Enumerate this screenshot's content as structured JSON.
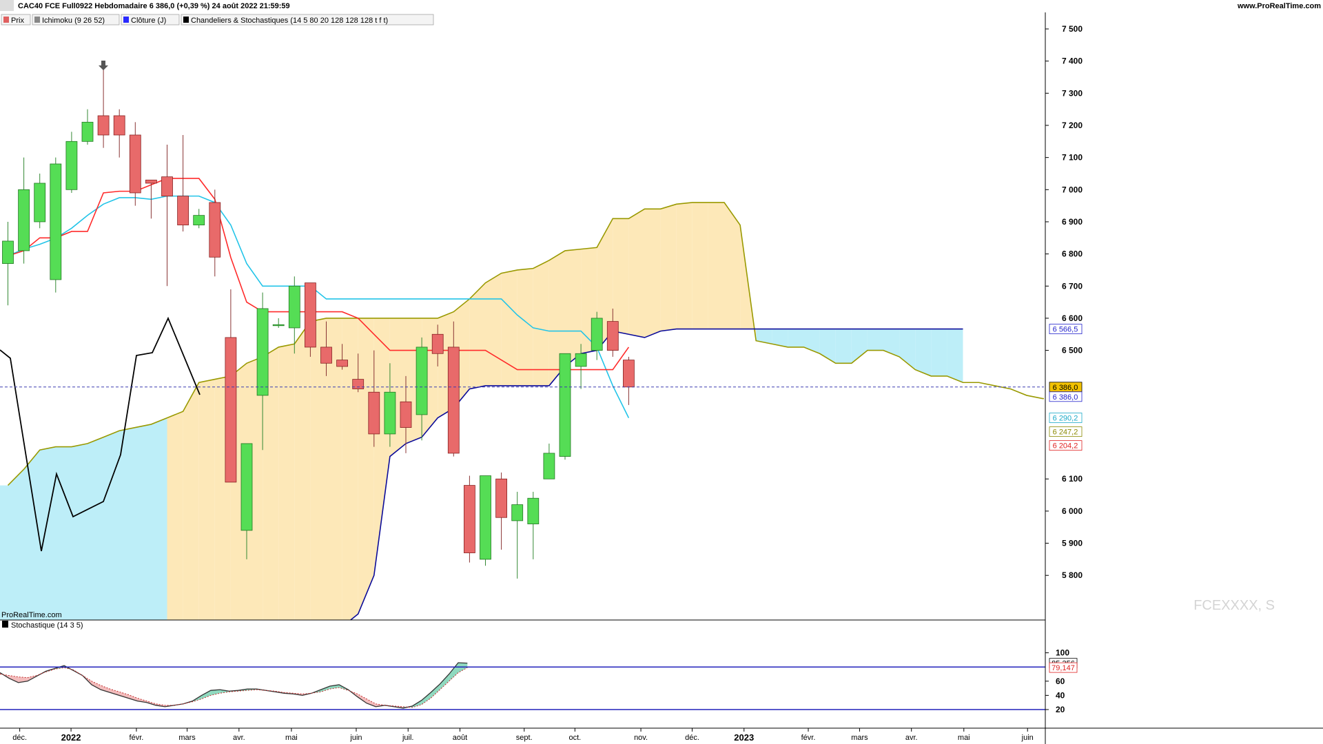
{
  "header": {
    "title": "CAC40 FCE Full0922 Hebdomadaire 6 386,0 (+0,39 %) 24 août 2022 21:59:59",
    "site": "www.ProRealTime.com",
    "legend": [
      {
        "label": "Prix",
        "color": "#e06060"
      },
      {
        "label": "Ichimoku (9 26 52)",
        "color": "#888888"
      },
      {
        "label": "Clôture (J)",
        "color": "#2a2aff"
      },
      {
        "label": "Chandeliers & Stochastiques (14 5 80 20 128 128 128 t f t)",
        "color": "#000000"
      }
    ]
  },
  "watermark": "FCEXXXX, S",
  "copyright": "ProRealTime.com",
  "stoch_panel": {
    "legend": "Stochastique (14 3 5)"
  },
  "price_axis": {
    "ticks": [
      "7 500",
      "7 400",
      "7 300",
      "7 200",
      "7 100",
      "7 000",
      "6 900",
      "6 800",
      "6 700",
      "6 600",
      "6 500",
      "6 100",
      "6 000",
      "5 900",
      "5 800"
    ],
    "tick_values": [
      7500,
      7400,
      7300,
      7200,
      7100,
      7000,
      6900,
      6800,
      6700,
      6600,
      6500,
      6100,
      6000,
      5900,
      5800
    ],
    "last_price_label": "6 386",
    "tags": [
      {
        "text": "6 566,5",
        "value": 6566.5,
        "color": "#2222cc",
        "bg": "#ffffff"
      },
      {
        "text": "6 386,0",
        "value": 6386,
        "color": "#000000",
        "bg": "#f2c200"
      },
      {
        "text": "6 386,0",
        "value": 6386,
        "color": "#2222cc",
        "bg": "#ffffff",
        "below": true
      },
      {
        "text": "6 290,2",
        "value": 6290.2,
        "color": "#1aaac8",
        "bg": "#ffffff"
      },
      {
        "text": "6 247,2",
        "value": 6247.2,
        "color": "#8a8a00",
        "bg": "#ffffff"
      },
      {
        "text": "6 204,2",
        "value": 6204.2,
        "color": "#e02020",
        "bg": "#ffffff"
      }
    ]
  },
  "stoch_axis": {
    "ticks": [
      "100",
      "60",
      "40",
      "20"
    ],
    "tick_values": [
      100,
      60,
      40,
      20
    ],
    "tags": [
      {
        "text": "85,356",
        "value": 85.356,
        "color": "#000000"
      },
      {
        "text": "79,147",
        "value": 79.147,
        "color": "#e02020"
      }
    ]
  },
  "time_axis": [
    {
      "label": "déc.",
      "bold": false
    },
    {
      "label": "2022",
      "bold": true
    },
    {
      "label": "févr.",
      "bold": false
    },
    {
      "label": "mars",
      "bold": false
    },
    {
      "label": "avr.",
      "bold": false
    },
    {
      "label": "mai",
      "bold": false
    },
    {
      "label": "juin",
      "bold": false
    },
    {
      "label": "juil.",
      "bold": false
    },
    {
      "label": "août",
      "bold": false
    },
    {
      "label": "sept.",
      "bold": false
    },
    {
      "label": "oct.",
      "bold": false
    },
    {
      "label": "nov.",
      "bold": false
    },
    {
      "label": "déc.",
      "bold": false
    },
    {
      "label": "2023",
      "bold": true
    },
    {
      "label": "févr.",
      "bold": false
    },
    {
      "label": "mars",
      "bold": false
    },
    {
      "label": "avr.",
      "bold": false
    },
    {
      "label": "mai",
      "bold": false
    },
    {
      "label": "juin",
      "bold": false
    }
  ],
  "colors": {
    "bull": "#55dd55",
    "bear": "#e86a6a",
    "kumo_bull": "#bdeef8",
    "kumo_bear": "#fde8b8",
    "tenkan": "#ff2a2a",
    "kijun": "#22c4e8",
    "ssa": "#0a0a99",
    "ssb": "#999900",
    "chikou": "#000000",
    "stoch_k": "#e05050",
    "stoch_line": "#2020bb"
  },
  "chart_data": {
    "type": "candlestick",
    "timeframe": "weekly",
    "candles": [
      {
        "o": 6770,
        "h": 6900,
        "l": 6640,
        "c": 6840
      },
      {
        "o": 6810,
        "h": 7100,
        "l": 6770,
        "c": 7000
      },
      {
        "o": 6900,
        "h": 7050,
        "l": 6880,
        "c": 7020
      },
      {
        "o": 6720,
        "h": 7100,
        "l": 6680,
        "c": 7080
      },
      {
        "o": 7000,
        "h": 7180,
        "l": 6990,
        "c": 7150
      },
      {
        "o": 7150,
        "h": 7250,
        "l": 7140,
        "c": 7210
      },
      {
        "o": 7230,
        "h": 7385,
        "l": 7130,
        "c": 7170
      },
      {
        "o": 7230,
        "h": 7250,
        "l": 7100,
        "c": 7170
      },
      {
        "o": 7170,
        "h": 7210,
        "l": 6950,
        "c": 6990
      },
      {
        "o": 7030,
        "h": 7030,
        "l": 6910,
        "c": 7020
      },
      {
        "o": 7040,
        "h": 7140,
        "l": 6700,
        "c": 6980
      },
      {
        "o": 6980,
        "h": 7170,
        "l": 6870,
        "c": 6890
      },
      {
        "o": 6890,
        "h": 6940,
        "l": 6880,
        "c": 6920
      },
      {
        "o": 6960,
        "h": 7000,
        "l": 6730,
        "c": 6790
      },
      {
        "o": 6540,
        "h": 6690,
        "l": 6180,
        "c": 6090
      },
      {
        "o": 5940,
        "h": 6200,
        "l": 5850,
        "c": 6210
      },
      {
        "o": 6360,
        "h": 6680,
        "l": 6190,
        "c": 6630
      },
      {
        "o": 6580,
        "h": 6600,
        "l": 6570,
        "c": 6580
      },
      {
        "o": 6570,
        "h": 6730,
        "l": 6490,
        "c": 6700
      },
      {
        "o": 6710,
        "h": 6710,
        "l": 6480,
        "c": 6510
      },
      {
        "o": 6510,
        "h": 6590,
        "l": 6420,
        "c": 6460
      },
      {
        "o": 6470,
        "h": 6520,
        "l": 6440,
        "c": 6450
      },
      {
        "o": 6410,
        "h": 6490,
        "l": 6370,
        "c": 6380
      },
      {
        "o": 6370,
        "h": 6500,
        "l": 6200,
        "c": 6240
      },
      {
        "o": 6240,
        "h": 6460,
        "l": 6200,
        "c": 6370
      },
      {
        "o": 6340,
        "h": 6420,
        "l": 6180,
        "c": 6260
      },
      {
        "o": 6300,
        "h": 6540,
        "l": 6220,
        "c": 6510
      },
      {
        "o": 6550,
        "h": 6580,
        "l": 6450,
        "c": 6490
      },
      {
        "o": 6510,
        "h": 6590,
        "l": 6170,
        "c": 6180
      },
      {
        "o": 6080,
        "h": 6110,
        "l": 5840,
        "c": 5870
      },
      {
        "o": 5850,
        "h": 6110,
        "l": 5830,
        "c": 6110
      },
      {
        "o": 6100,
        "h": 6120,
        "l": 5880,
        "c": 5980
      },
      {
        "o": 5970,
        "h": 6060,
        "l": 5790,
        "c": 6020
      },
      {
        "o": 5960,
        "h": 6060,
        "l": 5850,
        "c": 6040
      },
      {
        "o": 6100,
        "h": 6210,
        "l": 6120,
        "c": 6180
      },
      {
        "o": 6170,
        "h": 6490,
        "l": 6160,
        "c": 6490
      },
      {
        "o": 6450,
        "h": 6520,
        "l": 6380,
        "c": 6490
      },
      {
        "o": 6500,
        "h": 6620,
        "l": 6470,
        "c": 6600
      },
      {
        "o": 6590,
        "h": 6630,
        "l": 6480,
        "c": 6500
      },
      {
        "o": 6470,
        "h": 6480,
        "l": 6330,
        "c": 6386
      }
    ],
    "ichimoku": {
      "tenkan": [
        6794,
        6810,
        6850,
        6850,
        6870,
        6870,
        6990,
        6995,
        6995,
        7015,
        7035,
        7035,
        7035,
        6970,
        6789,
        6650,
        6620,
        6620,
        6620,
        6620,
        6620,
        6620,
        6600,
        6550,
        6500,
        6500,
        6500,
        6500,
        6500,
        6500,
        6500,
        6470,
        6440,
        6440,
        6440,
        6440,
        6440,
        6440,
        6440,
        6510
      ],
      "kijun": [
        6794,
        6815,
        6830,
        6849,
        6880,
        6920,
        6955,
        6975,
        6975,
        6970,
        6980,
        6980,
        6980,
        6960,
        6890,
        6770,
        6700,
        6700,
        6700,
        6700,
        6660,
        6660,
        6660,
        6660,
        6660,
        6660,
        6660,
        6660,
        6660,
        6660,
        6660,
        6660,
        6610,
        6570,
        6560,
        6560,
        6560,
        6510,
        6390,
        6290
      ],
      "ssb": [
        6080,
        6130,
        6190,
        6200,
        6200,
        6210,
        6230,
        6250,
        6260,
        6270,
        6290,
        6310,
        6400,
        6410,
        6420,
        6460,
        6480,
        6510,
        6520,
        6590,
        6600,
        6600,
        6600,
        6600,
        6600,
        6600,
        6600,
        6600,
        6620,
        6660,
        6710,
        6740,
        6750,
        6755,
        6780,
        6810,
        6815,
        6820,
        6910,
        6910,
        6940,
        6940,
        6955,
        6960,
        6960,
        6960,
        6890,
        6530,
        6520,
        6510,
        6510,
        6490,
        6460,
        6460,
        6500,
        6500,
        6480,
        6440,
        6420,
        6420,
        6400,
        6400,
        6390,
        6380,
        6360,
        6350,
        6350,
        6320,
        6280
      ],
      "ssa": [
        5640,
        5640,
        5640,
        5640,
        5640,
        5640,
        5640,
        5640,
        5640,
        5640,
        5640,
        5640,
        5680,
        5800,
        6170,
        6210,
        6230,
        6290,
        6320,
        6380,
        6390,
        6390,
        6390,
        6390,
        6390,
        6450,
        6490,
        6500,
        6560,
        6550,
        6540,
        6560,
        6566.5,
        6566.5,
        6566.5,
        6566.5,
        6566.5,
        6566.5,
        6566.5,
        6566.5,
        6566.5,
        6566.5,
        6566.5,
        6566.5,
        6566.5,
        6566.5,
        6566.5,
        6566.5,
        6566.5,
        6566.5,
        6566.5
      ],
      "ssa_start": 10,
      "chikou": [
        6480,
        6500,
        6340,
        6000,
        5680,
        6050,
        5840,
        6110,
        6010,
        6090,
        6370,
        6370,
        6600,
        6410,
        6386
      ],
      "chikou_start": -1
    },
    "last_close": 6386.0,
    "stochastic": {
      "k": [
        72,
        64,
        58,
        60,
        67,
        74,
        78,
        82,
        75,
        68,
        55,
        48,
        44,
        40,
        36,
        32,
        30,
        26,
        24,
        26,
        28,
        32,
        40,
        47,
        48,
        46,
        47,
        49,
        49,
        47,
        45,
        43,
        42,
        40,
        43,
        48,
        53,
        55,
        48,
        38,
        29,
        24,
        26,
        24,
        22,
        25,
        33,
        44,
        56,
        70,
        86,
        85.4
      ],
      "d": [
        70,
        68,
        66,
        65,
        68,
        73,
        77,
        79,
        76,
        68,
        60,
        54,
        49,
        45,
        41,
        36,
        32,
        28,
        26,
        26,
        28,
        31,
        35,
        40,
        43,
        45,
        46,
        47,
        48,
        47,
        46,
        44,
        43,
        42,
        43,
        45,
        49,
        51,
        47,
        42,
        35,
        28,
        26,
        25,
        24,
        23,
        27,
        36,
        48,
        60,
        72,
        79.1
      ],
      "overbought": 80,
      "oversold": 20
    },
    "ylim": [
      5760,
      7540
    ],
    "stoch_ylim": [
      0,
      105
    ]
  }
}
